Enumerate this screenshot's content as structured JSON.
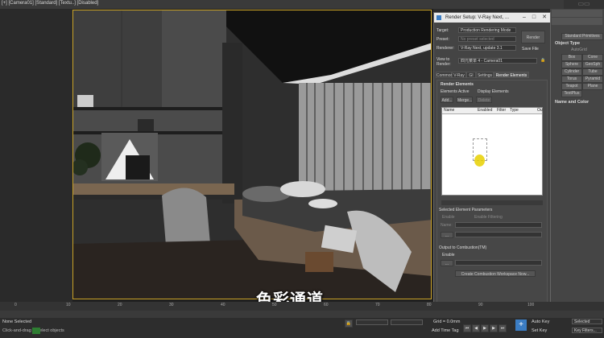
{
  "viewport": {
    "label": "[+] [Camera01] [Standard] [Textu..] [Disabled]",
    "subtitle": "色彩通道"
  },
  "dialog": {
    "title": "Render Setup: V-Ray Next, ...",
    "target_label": "Target:",
    "target_value": "Production Rendering Mode",
    "preset_label": "Preset:",
    "preset_value": "No preset selected",
    "renderer_label": "Renderer:",
    "renderer_value": "V-Ray Next, update 3.1",
    "view_label": "View to Render:",
    "view_value": "四元菜单 4 - Camera01",
    "render_button": "Render",
    "save_file": "Save File",
    "tabs": [
      "Common",
      "V-Ray",
      "GI",
      "Settings",
      "Render Elements"
    ],
    "active_tab": "Render Elements",
    "rollout_title": "Render Elements",
    "elements_active": "Elements Active",
    "display_elements": "Display Elements",
    "add_button": "Add...",
    "merge_button": "Merge...",
    "delete_button": "Delete",
    "columns": [
      "Name",
      "Enabled",
      "Filter",
      "Type",
      "Ou"
    ],
    "selected_params": "Selected Element Parameters",
    "enable_label": "Enable",
    "enable_filtering": "Enable Filtering",
    "name_label": "Name:",
    "combustion_title": "Output to Combustion(TM)",
    "combustion_enable": "Enable",
    "combustion_button": "Create Combustion Workspace Now..."
  },
  "command_panel": {
    "object_type": "Object Type",
    "autogrid": "AutoGrid",
    "standard_primitives": "Standard Primitives",
    "buttons": [
      "Box",
      "Cone",
      "Sphere",
      "GeoSph",
      "Cylinder",
      "Tube",
      "Torus",
      "Pyramid",
      "Teapot",
      "Plane",
      "TextPlus"
    ],
    "name_color": "Name and Color"
  },
  "status": {
    "selection": "None Selected",
    "prompt": "Click-and-drag to select objects",
    "grid": "Grid = 0.0mm",
    "add_time_tag": "Add Time Tag",
    "auto_key": "Auto Key",
    "set_key": "Set Key",
    "selected": "Selected",
    "key_filters": "Key Filters..."
  },
  "timeline": {
    "ticks": [
      "0",
      "10",
      "20",
      "30",
      "40",
      "50",
      "60",
      "70",
      "80",
      "90",
      "100"
    ]
  },
  "colors": {
    "selection_highlight": "#c9a227",
    "accent_blue": "#3b7dc4",
    "cursor_yellow": "#e8d000"
  }
}
